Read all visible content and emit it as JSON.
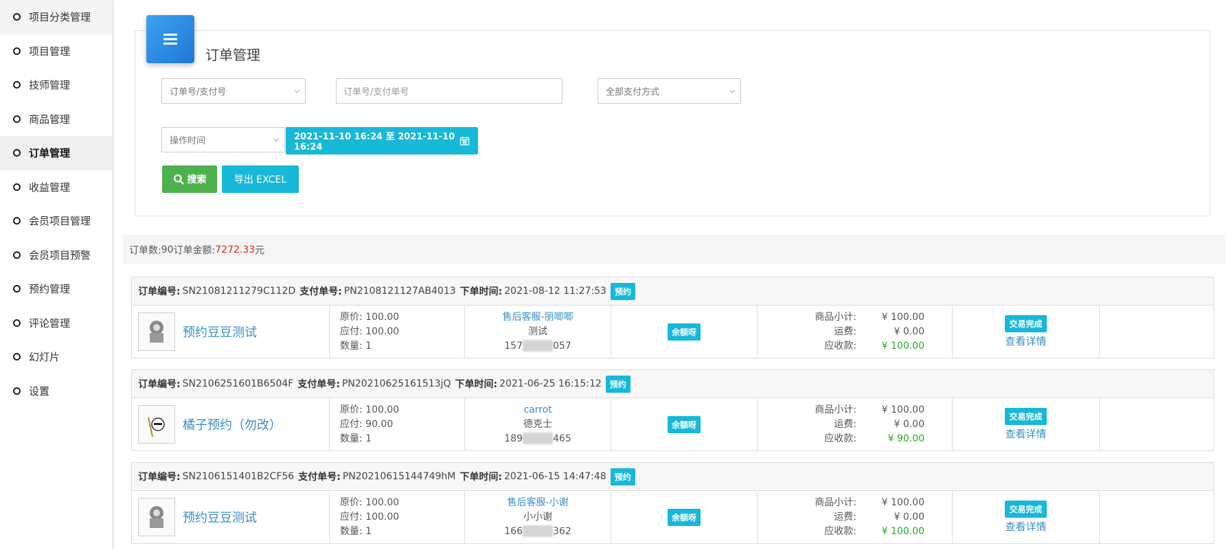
{
  "sidebar": {
    "items": [
      {
        "label": "项目分类管理"
      },
      {
        "label": "项目管理"
      },
      {
        "label": "技师管理"
      },
      {
        "label": "商品管理"
      },
      {
        "label": "订单管理"
      },
      {
        "label": "收益管理"
      },
      {
        "label": "会员项目管理"
      },
      {
        "label": "会员项目预警"
      },
      {
        "label": "预约管理"
      },
      {
        "label": "评论管理"
      },
      {
        "label": "幻灯片"
      },
      {
        "label": "设置"
      }
    ]
  },
  "panel": {
    "title": "订单管理",
    "search_type_select": "订单号/支付号",
    "search_input_placeholder": "订单号/支付单号",
    "payment_select": "全部支付方式",
    "time_select": "操作时间",
    "date_range": "2021-11-10 16:24 至 2021-11-10 16:24",
    "search_button": "搜索",
    "export_button": "导出 EXCEL"
  },
  "summary": {
    "count_label": "订单数: ",
    "count": "90",
    "amount_label": " 订单金额: ",
    "amount": "7272.33",
    "unit": "元"
  },
  "labels": {
    "order_no": "订单编号:",
    "pay_no": "支付单号:",
    "order_time": "下单时间:",
    "original_price": "原价:",
    "payable": "应付:",
    "quantity": "数量:",
    "subtotal": "商品小计:",
    "shipping": "运费:",
    "receivable": "应收款:"
  },
  "orders": [
    {
      "order_no": "SN21081211279C112D",
      "pay_no": "PN2108121127AB4013",
      "time": "2021-08-12 11:27:53",
      "badge": "预约",
      "product": "预约豆豆测试",
      "original_price": "100.00",
      "payable": "100.00",
      "quantity": "1",
      "user_name": "售后客服-丽唧唧",
      "user_nick": "测试",
      "phone_start": "157",
      "phone_end": "057",
      "payment": "余额呀",
      "subtotal": "¥ 100.00",
      "shipping": "¥ 0.00",
      "receivable": "¥ 100.00",
      "status": "交易完成",
      "detail": "查看详情"
    },
    {
      "order_no": "SN2106251601B6504F",
      "pay_no": "PN20210625161513jQ",
      "time": "2021-06-25 16:15:12",
      "badge": "预约",
      "product": "橘子预约（勿改）",
      "original_price": "100.00",
      "payable": "90.00",
      "quantity": "1",
      "user_name": "carrot",
      "user_nick": "德克士",
      "phone_start": "189",
      "phone_end": "465",
      "payment": "余额呀",
      "subtotal": "¥ 100.00",
      "shipping": "¥ 0.00",
      "receivable": "¥ 90.00",
      "status": "交易完成",
      "detail": "查看详情"
    },
    {
      "order_no": "SN2106151401B2CF56",
      "pay_no": "PN20210615144749hM",
      "time": "2021-06-15 14:47:48",
      "badge": "预约",
      "product": "预约豆豆测试",
      "original_price": "100.00",
      "payable": "100.00",
      "quantity": "1",
      "user_name": "售后客服-小谢",
      "user_nick": "小小谢",
      "phone_start": "166",
      "phone_end": "362",
      "payment": "余额呀",
      "subtotal": "¥ 100.00",
      "shipping": "¥ 0.00",
      "receivable": "¥ 100.00",
      "status": "交易完成",
      "detail": "查看详情"
    }
  ]
}
